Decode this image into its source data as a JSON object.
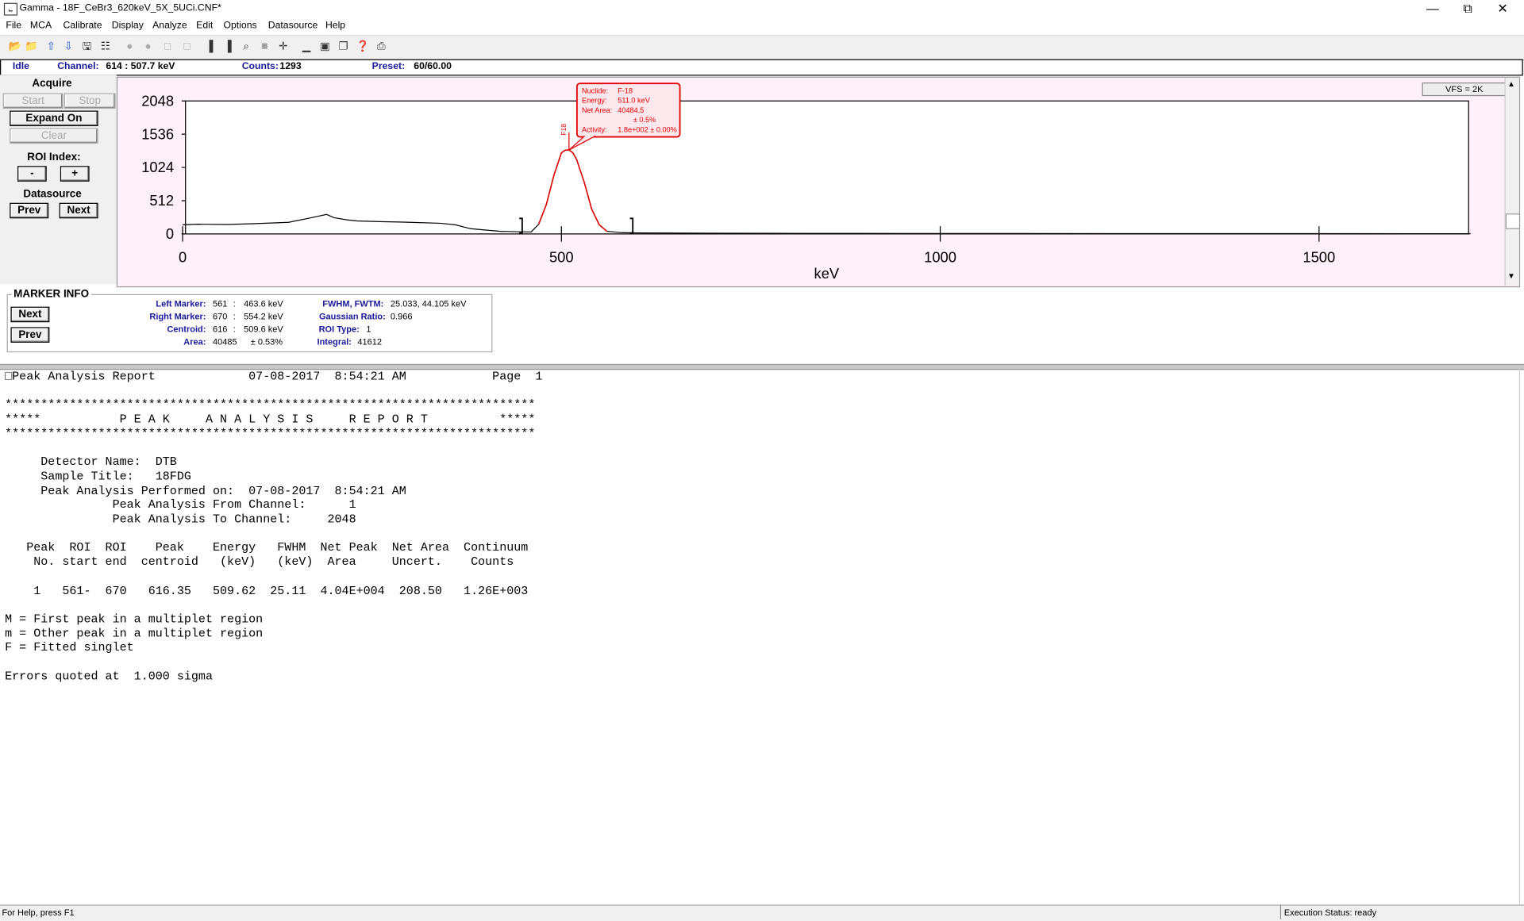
{
  "window": {
    "title": "Gamma - 18F_CeBr3_620keV_5X_5UCi.CNF*",
    "app_icon": "app-icon"
  },
  "menu": [
    "File",
    "MCA",
    "Calibrate",
    "Display",
    "Analyze",
    "Edit",
    "Options",
    "Datasource",
    "Help"
  ],
  "status_strip": {
    "mode": "Idle",
    "channel_label": "Channel:",
    "channel_value": "614  :   507.7 keV",
    "counts_label": "Counts:",
    "counts_value": "1293",
    "preset_label": "Preset:",
    "preset_value": "60/60.00"
  },
  "left_panel": {
    "acquire_label": "Acquire",
    "start": "Start",
    "stop": "Stop",
    "expand": "Expand On",
    "clear": "Clear",
    "roi_index_label": "ROI Index:",
    "roi_minus": "-",
    "roi_plus": "+",
    "datasource_label": "Datasource",
    "prev": "Prev",
    "next": "Next"
  },
  "chart": {
    "vfs": "VFS = 2K",
    "tooltip": {
      "nuclide_label": "Nuclide:",
      "nuclide": "F-18",
      "energy_label": "Energy:",
      "energy": "511.0 keV",
      "net_area_label": "Net Area:",
      "net_area": "40484.5",
      "net_area_unc": "± 0.5%",
      "activity_label": "Activity:",
      "activity": "1.8e+002 ± 0.00%"
    },
    "peak_marker": "F18"
  },
  "chart_data": {
    "type": "line",
    "xlabel": "keV",
    "ylabel": "",
    "xlim": [
      0,
      1700
    ],
    "ylim": [
      0,
      2048
    ],
    "x_ticks": [
      "0",
      "500",
      "1000",
      "1500"
    ],
    "y_ticks": [
      "2048",
      "1536",
      "1024",
      "512",
      "0"
    ],
    "roi": [
      463.6,
      554.2
    ],
    "series": [
      {
        "values_x": [
          0,
          20,
          60,
          100,
          140,
          170,
          190,
          200,
          215,
          230,
          260,
          300,
          340,
          360,
          380,
          400,
          420,
          440,
          460,
          470,
          480,
          490,
          500,
          505,
          510,
          515,
          520,
          530,
          540,
          550,
          560,
          580,
          600,
          700,
          900,
          1100,
          1300,
          1500,
          1700
        ],
        "values_y": [
          140,
          150,
          145,
          160,
          180,
          250,
          300,
          250,
          220,
          200,
          190,
          180,
          165,
          140,
          80,
          60,
          40,
          35,
          30,
          150,
          450,
          900,
          1250,
          1290,
          1293,
          1250,
          1150,
          800,
          380,
          140,
          40,
          20,
          15,
          10,
          8,
          6,
          5,
          4,
          3
        ],
        "color": "#000000"
      }
    ]
  },
  "marker_info": {
    "title": "MARKER INFO",
    "next": "Next",
    "prev": "Prev",
    "left_marker_label": "Left Marker:",
    "left_marker_ch": "561",
    "left_marker_kev": "463.6 keV",
    "right_marker_label": "Right Marker:",
    "right_marker_ch": "670",
    "right_marker_kev": "554.2 keV",
    "centroid_label": "Centroid:",
    "centroid_ch": "616",
    "centroid_kev": "509.6 keV",
    "area_label": "Area:",
    "area": "40485",
    "area_unc": "± 0.53%",
    "fwhm_label": "FWHM, FWTM:",
    "fwhm": "25.033, 44.105 keV",
    "gauss_label": "Gaussian Ratio:",
    "gauss": "0.966",
    "roi_type_label": "ROI Type:",
    "roi_type": "1",
    "integral_label": "Integral:",
    "integral": "41612"
  },
  "report": {
    "text": "□Peak Analysis Report             07-08-2017  8:54:21 AM            Page  1\n\n**************************************************************************\n*****           P E A K     A N A L Y S I S     R E P O R T          *****\n**************************************************************************\n\n     Detector Name:  DTB\n     Sample Title:   18FDG\n     Peak Analysis Performed on:  07-08-2017  8:54:21 AM\n               Peak Analysis From Channel:      1\n               Peak Analysis To Channel:     2048\n\n   Peak  ROI  ROI    Peak    Energy   FWHM  Net Peak  Net Area  Continuum\n    No. start end  centroid   (keV)   (keV)  Area     Uncert.    Counts\n\n    1   561-  670   616.35   509.62  25.11  4.04E+004  208.50   1.26E+003\n\nM = First peak in a multiplet region\nm = Other peak in a multiplet region\nF = Fitted singlet\n\nErrors quoted at  1.000 sigma"
  },
  "statusbar": {
    "help": "For Help, press F1",
    "exec": "Execution Status: ready"
  }
}
